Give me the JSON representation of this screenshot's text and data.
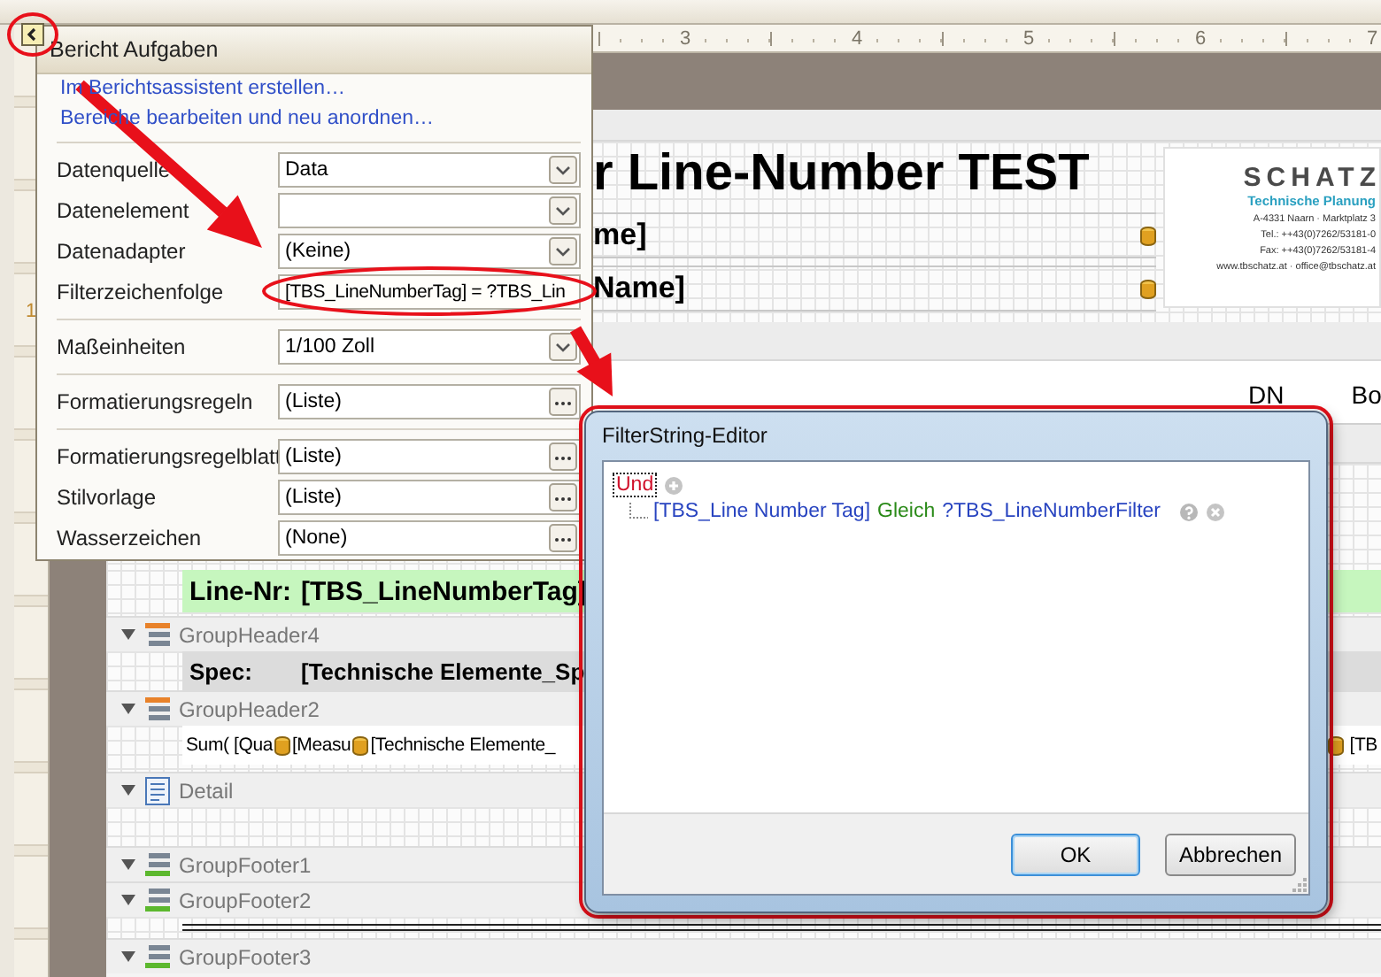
{
  "top_ruler": {
    "labels": [
      "3",
      "4",
      "5",
      "6",
      "7"
    ]
  },
  "left_ruler": {
    "labels": [
      "1"
    ]
  },
  "report": {
    "bands": [
      {
        "kind": "strip"
      },
      {
        "kind": "report_header",
        "title": "r Line-Number TEST",
        "fields": [
          "me]",
          "Name]"
        ],
        "logo": {
          "name": "SCHATZ",
          "tagline": "Technische Planung",
          "lines": [
            "A-4331 Naarn · Marktplatz 3",
            "Tel.: ++43(0)7262/53181-0",
            "Fax: ++43(0)7262/53181-4",
            "www.tbschatz.at · office@tbschatz.at"
          ]
        }
      },
      {
        "kind": "strip"
      },
      {
        "kind": "column_headers",
        "labels": [
          "DN",
          "Bo"
        ]
      },
      {
        "kind": "strip"
      },
      {
        "kind": "grid_area"
      },
      {
        "kind": "highlight_row",
        "label": "Line-Nr:",
        "value": "[TBS_LineNumberTag]"
      },
      {
        "kind": "header_caption",
        "label": "GroupHeader4"
      },
      {
        "kind": "spec_row",
        "label": "Spec:",
        "value": "[Technische Elemente_Sp"
      },
      {
        "kind": "header_caption",
        "label": "GroupHeader2"
      },
      {
        "kind": "field_row",
        "fields": [
          "Sum( [Qua",
          "[Measu",
          "[Technische Elemente_"
        ],
        "right_field": "[TB"
      },
      {
        "kind": "detail_caption",
        "label": "Detail"
      },
      {
        "kind": "grid_row"
      },
      {
        "kind": "footer_caption",
        "label": "GroupFooter1"
      },
      {
        "kind": "footer_caption",
        "label": "GroupFooter2"
      },
      {
        "kind": "line_row"
      },
      {
        "kind": "footer_caption",
        "label": "GroupFooter3"
      }
    ]
  },
  "task_panel": {
    "title": "Bericht Aufgaben",
    "smart_tag_highlighted": true,
    "links": [
      "Im Berichtsassistent erstellen…",
      "Bereiche bearbeiten und neu anordnen…"
    ],
    "property_groups": [
      [
        {
          "label": "Datenquelle",
          "value": "Data",
          "kind": "dropdown",
          "highlighted": false
        },
        {
          "label": "Datenelement",
          "kind": "dropdown",
          "highlighted": false
        },
        {
          "label": "Datenadapter",
          "value": "(Keine)",
          "kind": "dropdown",
          "highlighted": false
        },
        {
          "label": "Filterzeichenfolge",
          "value": "[TBS_LineNumberTag] = ?TBS_Lin",
          "kind": "text",
          "highlighted": true
        }
      ],
      [
        {
          "label": "Maßeinheiten",
          "value": "1/100 Zoll",
          "kind": "dropdown",
          "highlighted": false
        }
      ],
      [
        {
          "label": "Formatierungsregeln",
          "value": "(Liste)",
          "kind": "ellipsis",
          "highlighted": false
        }
      ],
      [
        {
          "label": "Formatierungsregelblatt",
          "value": "(Liste)",
          "kind": "ellipsis",
          "highlighted": false
        },
        {
          "label": "Stilvorlage",
          "value": "(Liste)",
          "kind": "ellipsis",
          "highlighted": false
        },
        {
          "label": "Wasserzeichen",
          "value": "(None)",
          "kind": "ellipsis",
          "highlighted": false
        }
      ]
    ]
  },
  "filter_dialog": {
    "title": "FilterString-Editor",
    "highlighted": true,
    "root": {
      "operator": "Und",
      "focused": true,
      "conditions": [
        {
          "field": "[TBS_Line Number Tag]",
          "operation": "Gleich",
          "value": "?TBS_LineNumberFilter"
        }
      ]
    },
    "buttons": [
      {
        "label": "OK",
        "default": true
      },
      {
        "label": "Abbrechen",
        "default": false
      }
    ]
  }
}
